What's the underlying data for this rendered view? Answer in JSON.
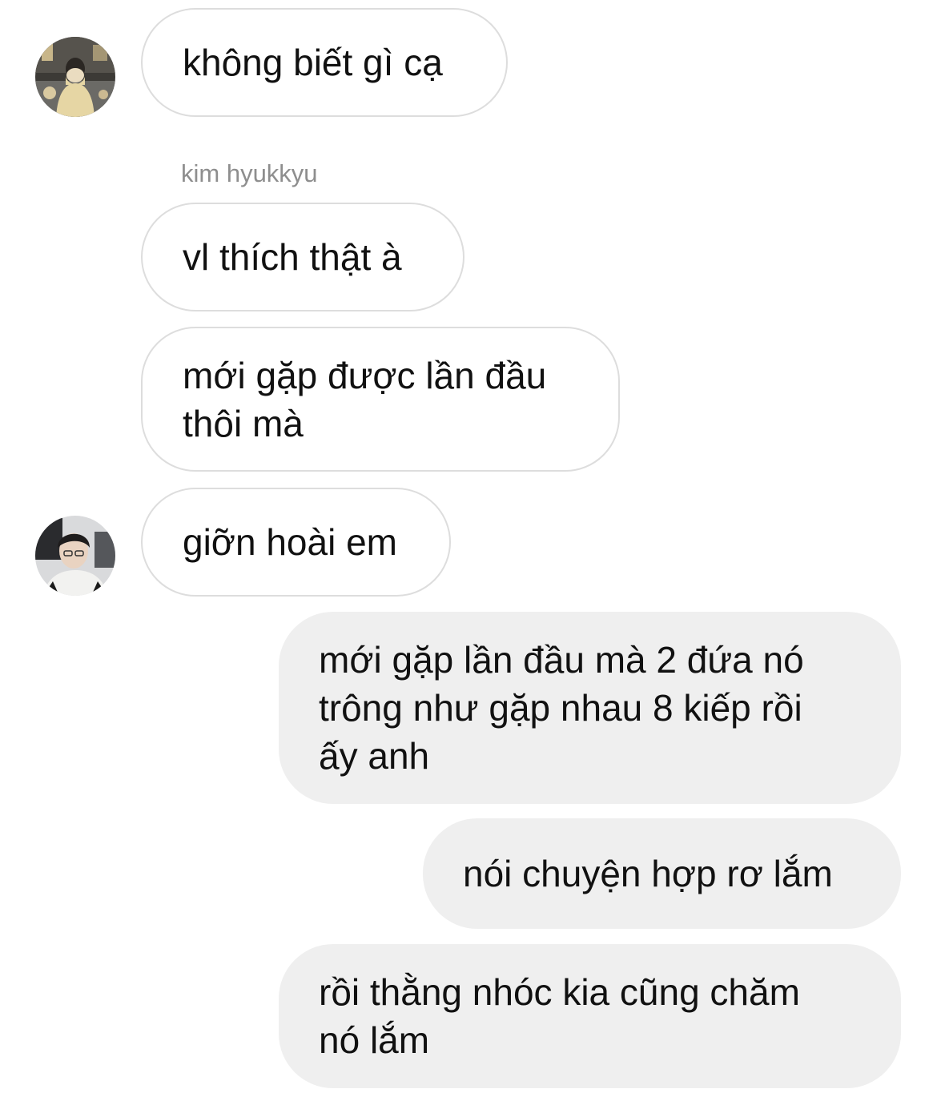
{
  "thread": {
    "messages": [
      {
        "direction": "incoming",
        "text": "không biết gì cạ"
      },
      {
        "direction": "incoming",
        "sender": "kim hyukkyu",
        "text": "vl thích thật à"
      },
      {
        "direction": "incoming",
        "text": "mới gặp được lần đầu\nthôi mà"
      },
      {
        "direction": "incoming",
        "text": "giỡn hoài em"
      },
      {
        "direction": "outgoing",
        "text": "mới gặp lần đầu mà 2 đứa nó\ntrông như gặp nhau 8 kiếp rồi\nấy anh"
      },
      {
        "direction": "outgoing",
        "text": "nói chuyện hợp rơ lắm"
      },
      {
        "direction": "outgoing",
        "text": "rồi thằng nhóc kia cũng chăm\nnó lắm"
      }
    ]
  },
  "colors": {
    "incoming_bubble_bg": "#ffffff",
    "incoming_bubble_border": "#dddddd",
    "outgoing_bubble_bg": "#efefef",
    "text": "#111111",
    "sender_name": "#8e8e8e"
  },
  "avatars": [
    {
      "icon": "user-photo-avatar"
    },
    {
      "icon": "user-photo-avatar"
    }
  ]
}
